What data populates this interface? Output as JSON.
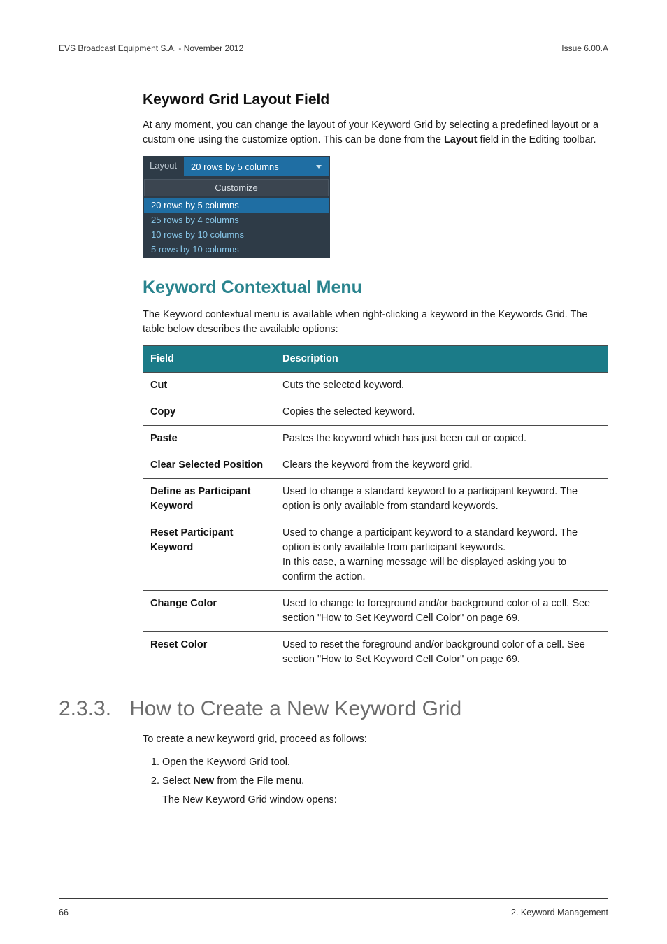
{
  "running": {
    "left": "EVS Broadcast Equipment S.A.  - November 2012",
    "right": "Issue 6.00.A"
  },
  "sec1": {
    "title": "Keyword Grid Layout Field",
    "p1a": "At any moment, you can change the layout of your Keyword Grid by selecting a predefined layout or a custom one using the customize option. This can be done from the ",
    "p1b": "Layout",
    "p1c": " field in the Editing toolbar."
  },
  "layout_widget": {
    "label": "Layout",
    "selected": "20 rows by 5 columns",
    "customize": "Customize",
    "items": [
      "20 rows by 5 columns",
      "25 rows by 4 columns",
      "10 rows by 10 columns",
      "5 rows by 10 columns"
    ]
  },
  "sec2": {
    "title": "Keyword Contextual Menu",
    "p1": "The Keyword contextual menu is available when right-clicking a keyword in the Keywords Grid. The table below describes the available options:"
  },
  "table": {
    "headers": {
      "field": "Field",
      "desc": "Description"
    },
    "rows": [
      {
        "field": "Cut",
        "desc": "Cuts the selected keyword."
      },
      {
        "field": "Copy",
        "desc": "Copies the selected keyword."
      },
      {
        "field": "Paste",
        "desc": "Pastes the keyword which has just been cut or copied."
      },
      {
        "field": "Clear Selected Position",
        "desc": "Clears the keyword from the keyword grid."
      },
      {
        "field": "Define as Participant Keyword",
        "desc": "Used to change a standard keyword to a participant keyword. The option is only available from standard keywords."
      },
      {
        "field": "Reset Participant Keyword",
        "desc": "Used to change a participant keyword to a standard keyword. The option is only available from participant keywords.\nIn this case, a warning message will be displayed asking you to confirm the action."
      },
      {
        "field": "Change Color",
        "desc": "Used to change to foreground and/or background color of a cell. See section \"How to Set Keyword Cell Color\" on page 69."
      },
      {
        "field": "Reset Color",
        "desc": "Used to reset the foreground and/or background color of a cell. See section \"How to Set Keyword Cell Color\" on page 69."
      }
    ]
  },
  "sec3": {
    "num": "2.3.3.",
    "title": "How to Create a New Keyword Grid",
    "p1": "To create a new keyword grid, proceed as follows:",
    "steps": {
      "s1": "Open the Keyword Grid tool.",
      "s2a": "Select ",
      "s2b": "New",
      "s2c": " from the File menu.",
      "s2_sub": "The New Keyword Grid window opens:"
    }
  },
  "footer": {
    "page": "66",
    "chapter": "2. Keyword Management"
  }
}
